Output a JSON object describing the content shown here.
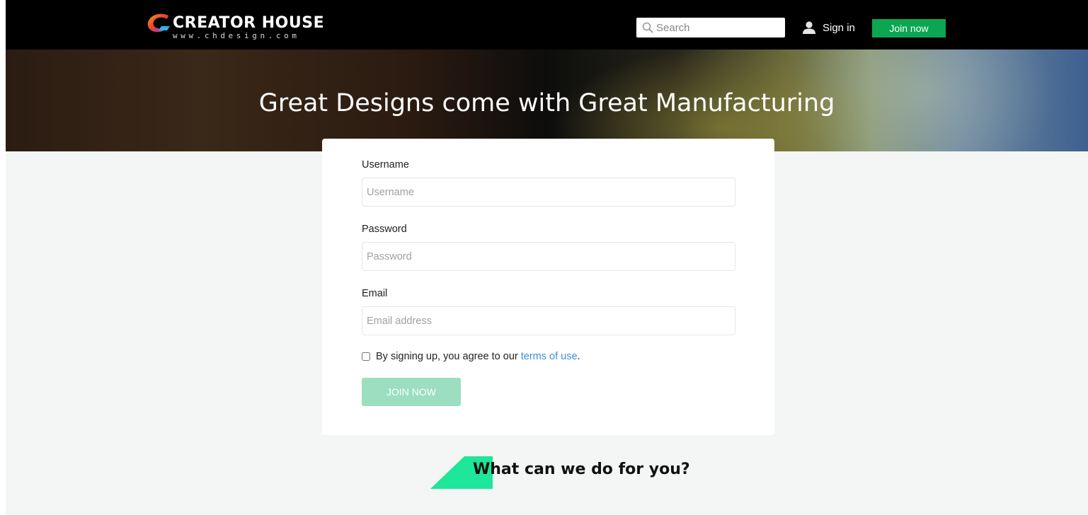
{
  "colors": {
    "navbar_bg": "#000000",
    "join_green": "#0aa651",
    "submit_green_disabled": "#9cdec0",
    "link_blue": "#3b8fd6",
    "accent_shape": "#1ee69a"
  },
  "header": {
    "logo_title": "CREATOR HOUSE",
    "logo_subtitle": "www.chdesign.com",
    "search_placeholder": "Search",
    "sign_in_label": "Sign in",
    "join_label": "Join now",
    "icons": [
      "logo-swirl-icon",
      "search-icon",
      "user-icon"
    ]
  },
  "hero": {
    "title": "Great Designs come with Great Manufacturing"
  },
  "form": {
    "username_label": "Username",
    "username_placeholder": "Username",
    "password_label": "Password",
    "password_placeholder": "Password",
    "email_label": "Email",
    "email_placeholder": "Email address",
    "terms_text": "By signing up, you agree to our ",
    "terms_link": "terms of use",
    "terms_suffix": ".",
    "submit_label": "JOIN NOW"
  },
  "section": {
    "title": "What can we do for you?"
  }
}
